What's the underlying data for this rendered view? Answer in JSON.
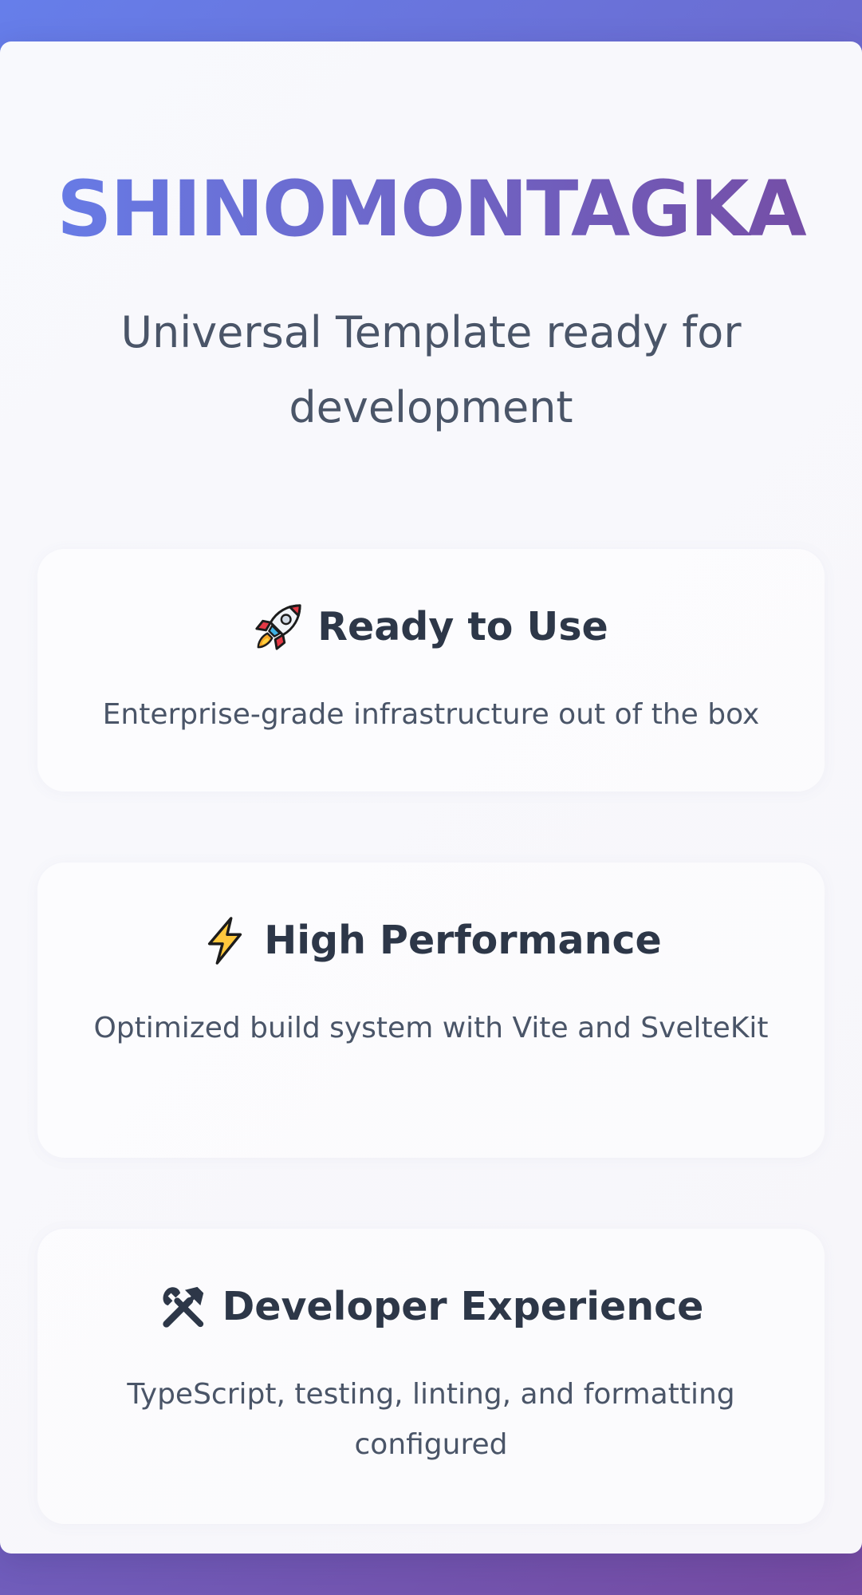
{
  "hero": {
    "brand": "SHINOMONTAGKA",
    "tagline": "Universal Template ready for development"
  },
  "features": [
    {
      "icon": "rocket-icon",
      "title": "Ready to Use",
      "description": "Enterprise-grade infrastructure out of the box"
    },
    {
      "icon": "lightning-bolt-icon",
      "title": "High Performance",
      "description": "Optimized build system with Vite and SvelteKit"
    },
    {
      "icon": "hammer-wrench-icon",
      "title": "Developer Experience",
      "description": "TypeScript, testing, linting, and formatting configured"
    }
  ],
  "colors": {
    "gradient_start": "#667eea",
    "gradient_end": "#764ba2",
    "heading_text": "#2d3748",
    "body_text": "#4a5568"
  }
}
